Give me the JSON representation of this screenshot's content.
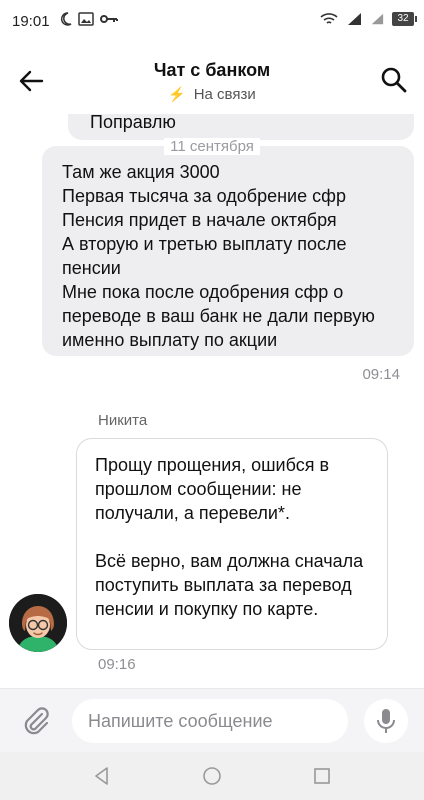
{
  "status_bar": {
    "time": "19:01",
    "battery": "32"
  },
  "header": {
    "title": "Чат с банком",
    "status": "На связи"
  },
  "messages": {
    "prev_partial": "Поправлю",
    "date_separator": "11 сентября",
    "user_message_lines": [
      "Там же акция 3000",
      "Первая тысяча за одобрение сфр",
      "Пенсия придет в начале октября",
      "А вторую и третью выплату после",
      "пенсии",
      "Мне пока после одобрения сфр о",
      "переводе в ваш банк не дали первую",
      "именно выплату по акции"
    ],
    "user_time": "09:14",
    "agent_name": "Никита",
    "agent_text": "Прощу прощения, ошибся в прошлом сообщении: не получали, а перевели*.\n\nВсё верно, вам должна сначала поступить выплата за перевод пенсии и покупку по карте.",
    "agent_time": "09:16"
  },
  "input": {
    "placeholder": "Напишите сообщение"
  },
  "colors": {
    "accent_green": "#22b04a",
    "bubble_gray": "#eeeef0"
  }
}
